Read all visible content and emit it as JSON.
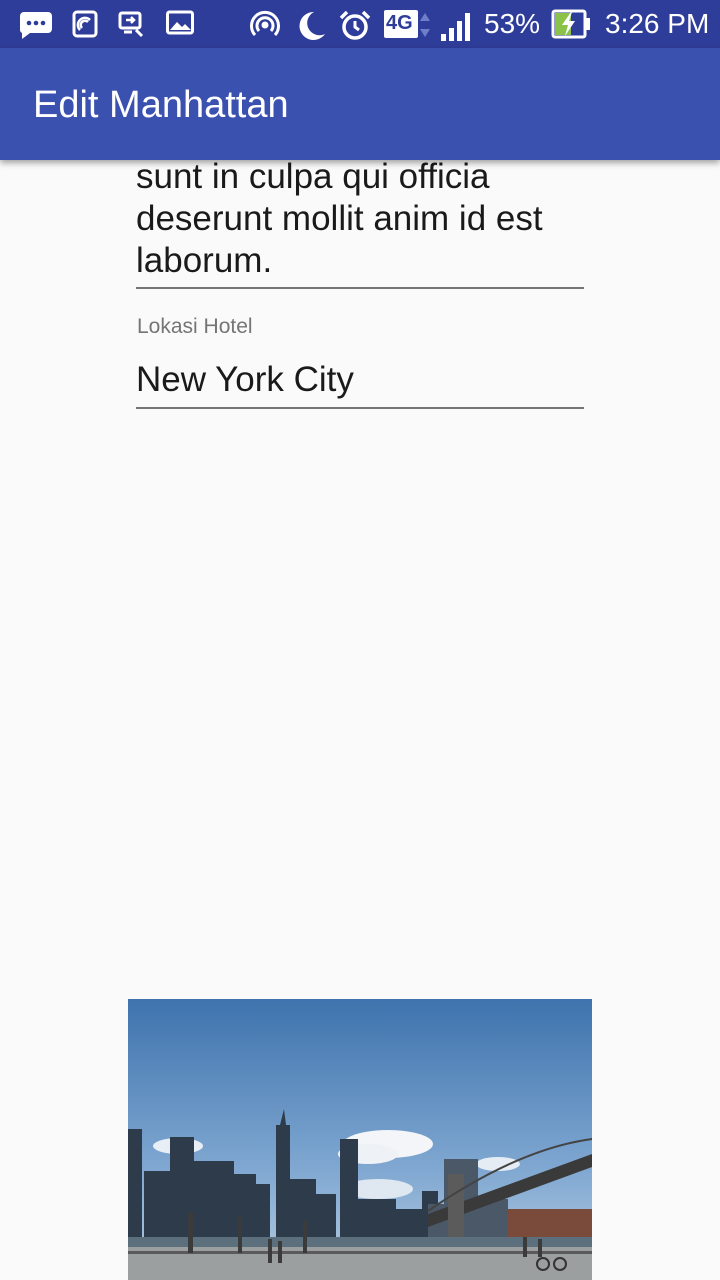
{
  "status_bar": {
    "battery": "53%",
    "time": "3:26 PM",
    "network": "4G",
    "icons": [
      "chat-icon",
      "nfc-icon",
      "screen-cast-icon",
      "gallery-icon",
      "hotspot-icon",
      "moon-icon",
      "alarm-icon",
      "network-4g-icon",
      "signal-icon",
      "battery-charging-icon"
    ]
  },
  "app_bar": {
    "title": "Edit Manhattan"
  },
  "form": {
    "description_text": "sunt in culpa qui officia deserunt mollit anim id est laborum.",
    "location_label": "Lokasi Hotel",
    "location_value": "New York City"
  },
  "photo": {
    "icon": "hotel-photo-manhattan-skyline"
  },
  "colors": {
    "status_bar": "#2f3d9a",
    "app_bar": "#3b51b0",
    "background": "#fafafa",
    "text": "#1a1a1a",
    "label": "#757575"
  }
}
